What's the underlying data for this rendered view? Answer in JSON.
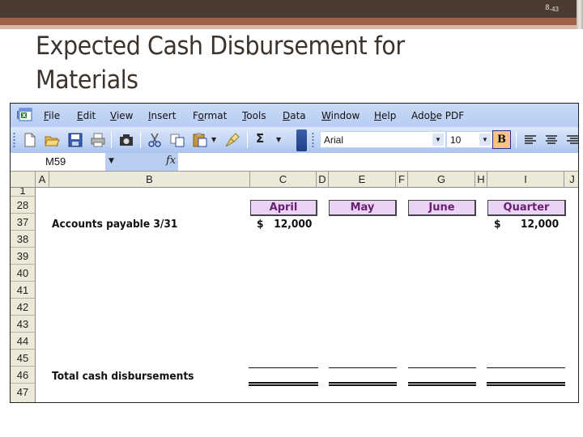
{
  "slide": {
    "number": "8",
    "number_sub": "-43",
    "title": "Expected Cash Disbursement for Materials"
  },
  "excel": {
    "menu": [
      {
        "label": "File",
        "accel": "F"
      },
      {
        "label": "Edit",
        "accel": "E"
      },
      {
        "label": "View",
        "accel": "V"
      },
      {
        "label": "Insert",
        "accel": "I"
      },
      {
        "label": "Format",
        "accel": "o"
      },
      {
        "label": "Tools",
        "accel": "T"
      },
      {
        "label": "Data",
        "accel": "D"
      },
      {
        "label": "Window",
        "accel": "W"
      },
      {
        "label": "Help",
        "accel": "H"
      },
      {
        "label": "Adobe PDF",
        "accel": "b"
      }
    ],
    "toolbar": {
      "icons": [
        "new-icon",
        "open-icon",
        "save-icon",
        "print-icon",
        "camera-icon",
        "cut-icon",
        "copy-icon",
        "paste-icon",
        "format-painter-icon",
        "autosum-icon"
      ],
      "font_name": "Arial",
      "font_size": "10",
      "bold_label": "B",
      "autosum_label": "Σ"
    },
    "formula_bar": {
      "name_box": "M59",
      "fx_label": "fx",
      "formula": ""
    },
    "columns": [
      "A",
      "B",
      "C",
      "D",
      "E",
      "F",
      "G",
      "H",
      "I",
      "J"
    ],
    "rows": [
      "1",
      "28",
      "37",
      "38",
      "39",
      "40",
      "41",
      "42",
      "43",
      "44",
      "45",
      "46",
      "47"
    ],
    "headers": {
      "april": "April",
      "may": "May",
      "june": "June",
      "quarter": "Quarter"
    },
    "row37": {
      "label": "Accounts payable 3/31",
      "april": "$   12,000",
      "quarter_dollar": "$",
      "quarter_value": "12,000"
    },
    "row46": {
      "label": "Total cash disbursements"
    }
  }
}
